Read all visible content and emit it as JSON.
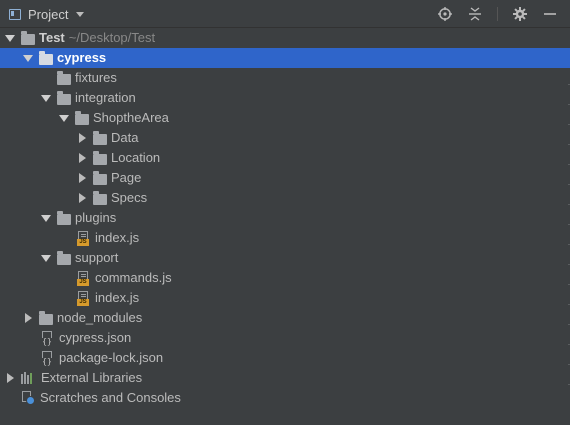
{
  "header": {
    "title": "Project"
  },
  "tree": [
    {
      "label": "Test",
      "suffix": "~/Desktop/Test",
      "bold": true
    },
    {
      "label": "cypress",
      "bold": true
    },
    {
      "label": "fixtures"
    },
    {
      "label": "integration"
    },
    {
      "label": "ShoptheArea"
    },
    {
      "label": "Data"
    },
    {
      "label": "Location"
    },
    {
      "label": "Page"
    },
    {
      "label": "Specs"
    },
    {
      "label": "plugins"
    },
    {
      "label": "index.js"
    },
    {
      "label": "support"
    },
    {
      "label": "commands.js"
    },
    {
      "label": "index.js"
    },
    {
      "label": "node_modules"
    },
    {
      "label": "cypress.json"
    },
    {
      "label": "package-lock.json"
    },
    {
      "label": "External Libraries"
    },
    {
      "label": "Scratches and Consoles"
    }
  ],
  "icons": {
    "js_badge": "JS",
    "json_badge": "{}"
  },
  "colors": {
    "panel_bg": "#3c3f41",
    "selection": "#2f65ca",
    "text": "#bbbbbb",
    "js_badge": "#d69a2c"
  }
}
